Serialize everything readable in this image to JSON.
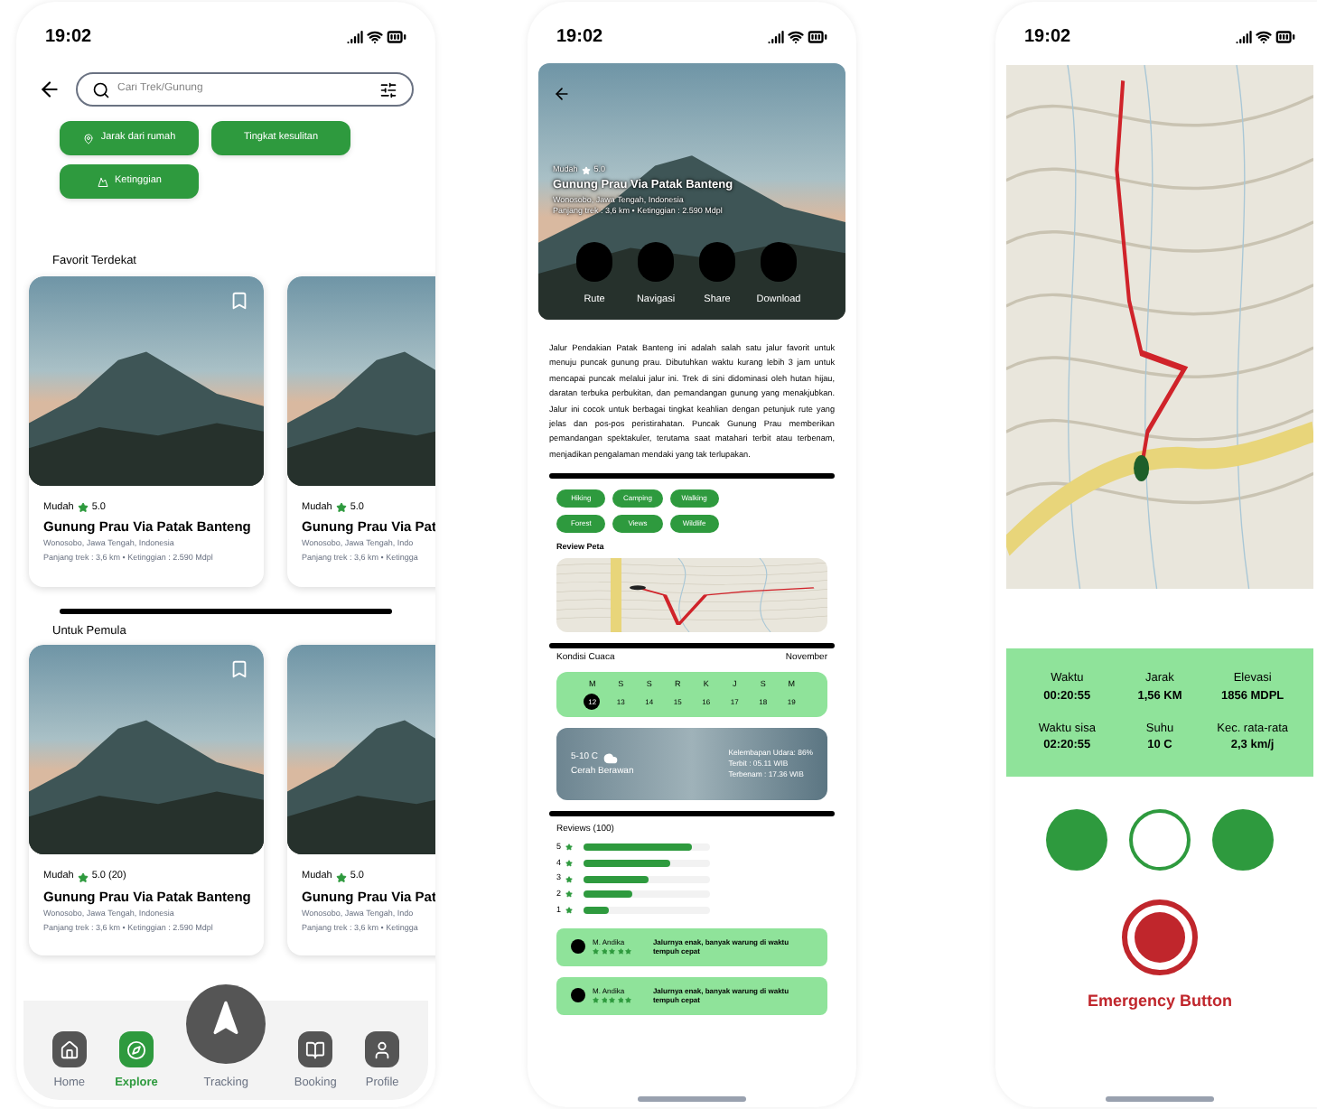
{
  "explore_screen": {
    "status_time": "19:02",
    "search": {
      "placeholder": "Cari Trek/Gunung"
    },
    "filters": [
      {
        "label": "Jarak dari rumah",
        "kind": "pin"
      },
      {
        "label": "Tingkat kesulitan",
        "kind": "plain"
      },
      {
        "label": "Ketinggian",
        "kind": "mountain"
      }
    ],
    "sections": [
      {
        "title": "Favorit Terdekat",
        "cards": [
          {
            "difficulty": "Mudah",
            "rating": "5.0",
            "name": "Gunung Prau Via Patak Banteng",
            "location": "Wonosobo, Jawa Tengah, Indonesia",
            "details": "Panjang trek : 3,6 km • Ketinggian : 2.590 Mdpl"
          },
          {
            "difficulty": "Mudah",
            "rating": "5.0",
            "name": "Gunung Prau Via Pat",
            "location": "Wonosobo, Jawa Tengah, Indo",
            "details": "Panjang trek : 3,6 km • Ketingga"
          }
        ]
      },
      {
        "title": "Untuk Pemula",
        "cards": [
          {
            "difficulty": "Mudah",
            "rating": "5.0 (20)",
            "name": "Gunung Prau Via Patak Banteng",
            "location": "Wonosobo, Jawa Tengah, Indonesia",
            "details": "Panjang trek : 3,6 km • Ketinggian : 2.590 Mdpl"
          },
          {
            "difficulty": "Mudah",
            "rating": "5.0",
            "name": "Gunung Prau Via Pat",
            "location": "Wonosobo, Jawa Tengah, Indo",
            "details": "Panjang trek : 3,6 km • Ketingga"
          }
        ]
      }
    ],
    "nav": [
      {
        "label": "Home",
        "kind": "home",
        "selected": false
      },
      {
        "label": "Explore",
        "kind": "compass",
        "selected": true
      },
      {
        "label": "Tracking",
        "kind": "tracking",
        "selected": false
      },
      {
        "label": "Booking",
        "kind": "booking",
        "selected": false
      },
      {
        "label": "Profile",
        "kind": "profile",
        "selected": false
      }
    ]
  },
  "detail_screen": {
    "status_time": "19:02",
    "hero": {
      "difficulty": "Mudah",
      "rating": "5.0",
      "title": "Gunung Prau Via Patak Banteng",
      "location": "Wonosobo, Jawa Tengah, Indonesia",
      "details": "Panjang trek : 3,6 km • Ketinggian : 2.590 Mdpl",
      "actions": [
        "Rute",
        "Navigasi",
        "Share",
        "Download"
      ]
    },
    "description": "Jalur Pendakian Patak Banteng ini adalah salah satu jalur favorit untuk menuju puncak gunung prau. Dibutuhkan waktu kurang lebih 3 jam untuk mencapai puncak melalui jalur ini. Trek di sini didominasi oleh hutan hijau, daratan terbuka perbukitan, dan pemandangan gunung yang menakjubkan. Jalur ini cocok untuk berbagai tingkat keahlian dengan petunjuk rute yang jelas dan pos-pos peristirahatan. Puncak Gunung Prau memberikan pemandangan spektakuler, terutama saat matahari terbit atau terbenam, menjadikan pengalaman mendaki yang tak terlupakan.",
    "tags": [
      "Hiking",
      "Camping",
      "Walking",
      "Forest",
      "Views",
      "Wildlife"
    ],
    "map_title": "Review Peta",
    "weather": {
      "title": "Kondisi Cuaca",
      "month": "November",
      "weekdays": [
        "M",
        "S",
        "S",
        "R",
        "K",
        "J",
        "S",
        "M"
      ],
      "dates": [
        {
          "label": "12",
          "selected": true
        },
        {
          "label": "13",
          "selected": false
        },
        {
          "label": "14",
          "selected": false
        },
        {
          "label": "15",
          "selected": false
        },
        {
          "label": "16",
          "selected": false
        },
        {
          "label": "17",
          "selected": false
        },
        {
          "label": "18",
          "selected": false
        },
        {
          "label": "19",
          "selected": false
        }
      ],
      "temperature": "5-10 C",
      "condition": "Cerah Berawan",
      "facts": [
        "Kelembapan Udara: 86%",
        "Terbit : 05.11 WIB",
        "Terbenam : 17.36 WIB"
      ]
    },
    "reviews": {
      "title": "Reviews (100)",
      "bars": [
        {
          "label": "5",
          "level": 0.85
        },
        {
          "label": "4",
          "level": 0.68
        },
        {
          "label": "3",
          "level": 0.52
        },
        {
          "label": "2",
          "level": 0.38
        },
        {
          "label": "1",
          "level": 0.2
        }
      ],
      "items": [
        {
          "name": "M. Andika",
          "stars": 5,
          "comment": "Jalurnya enak, banyak warung di waktu tempuh cepat"
        },
        {
          "name": "M. Andika",
          "stars": 5,
          "comment": "Jalurnya enak, banyak warung di waktu tempuh cepat"
        }
      ]
    }
  },
  "tracking_screen": {
    "status_time": "19:02",
    "stats": [
      {
        "label": "Waktu",
        "value": "00:20:55"
      },
      {
        "label": "Jarak",
        "value": "1,56 KM"
      },
      {
        "label": "Elevasi",
        "value": "1856 MDPL"
      },
      {
        "label": "Waktu sisa",
        "value": "02:20:55"
      },
      {
        "label": "Suhu",
        "value": "10 C"
      },
      {
        "label": "Kec. rata-rata",
        "value": "2,3 km/j"
      }
    ],
    "controls": [
      {
        "kind": "filled"
      },
      {
        "kind": "outline"
      },
      {
        "kind": "filled"
      }
    ],
    "emergency_label": "Emergency Button"
  }
}
